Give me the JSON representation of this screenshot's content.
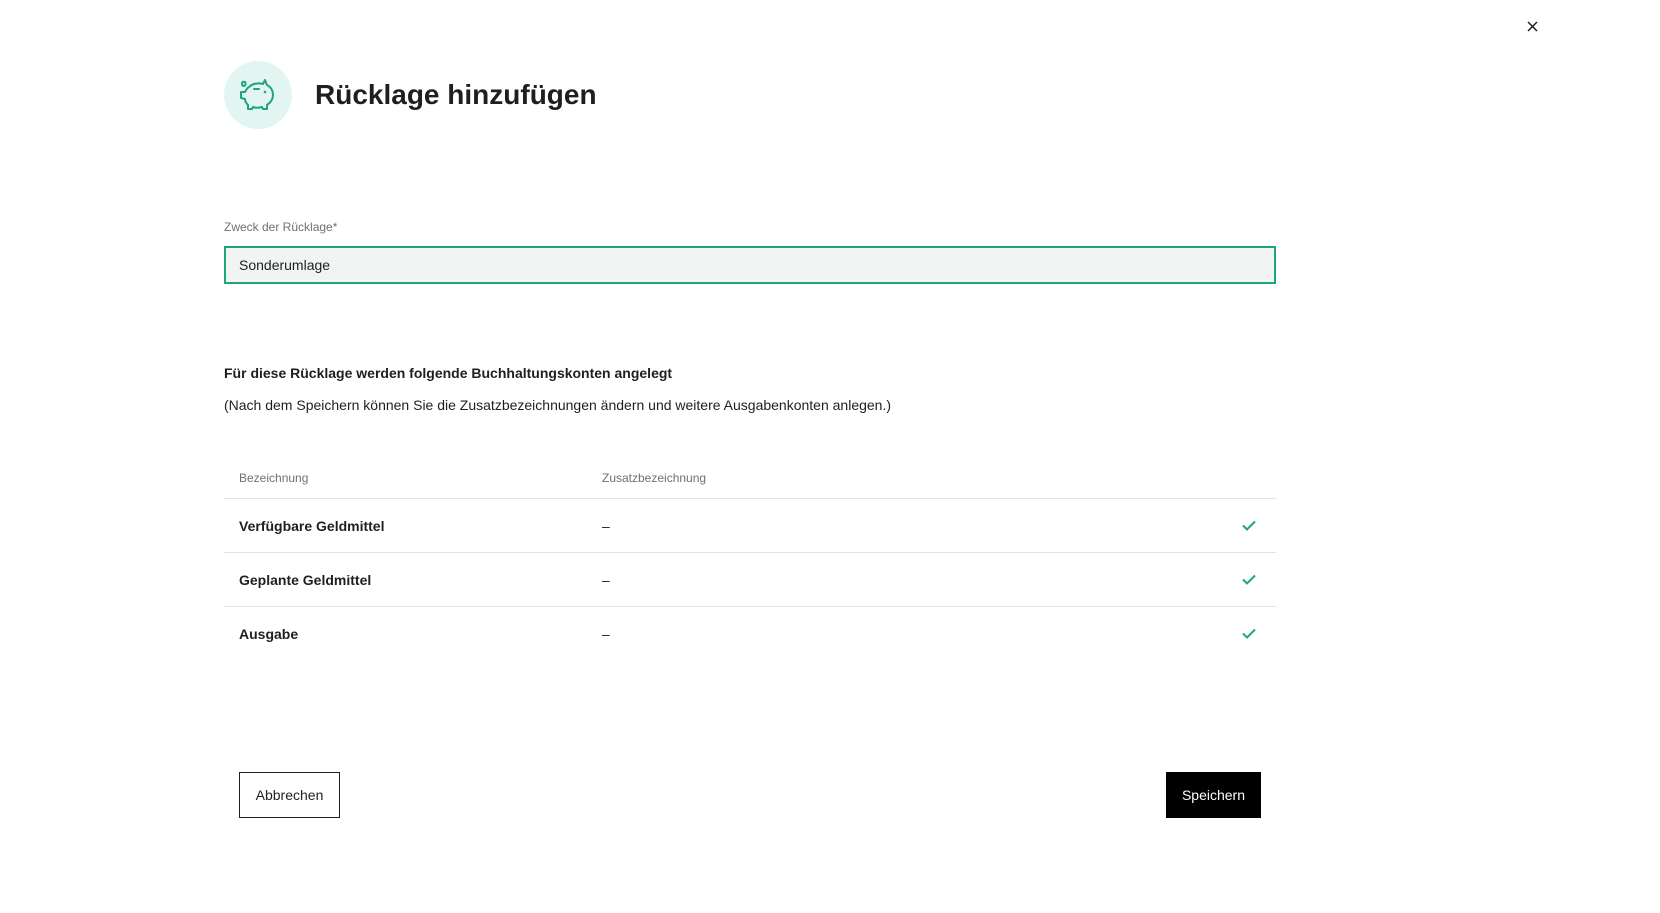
{
  "dialog": {
    "title": "Rücklage hinzufügen",
    "close_icon": "close-icon",
    "header_icon": "piggy-bank-icon"
  },
  "form": {
    "purpose_label": "Zweck der Rücklage*",
    "purpose_value": "Sonderumlage"
  },
  "accounts": {
    "heading": "Für diese Rücklage werden folgende Buchhaltungskonten angelegt",
    "note": "(Nach dem Speichern können Sie die Zusatzbezeichnungen ändern und weitere Ausgabenkonten anlegen.)",
    "columns": [
      "Bezeichnung",
      "Zusatzbezeichnung"
    ],
    "rows": [
      {
        "name": "Verfügbare Geldmittel",
        "extra": "–"
      },
      {
        "name": "Geplante Geldmittel",
        "extra": "–"
      },
      {
        "name": "Ausgabe",
        "extra": "–"
      }
    ],
    "status_icon": "check-icon"
  },
  "actions": {
    "cancel_label": "Abbrechen",
    "save_label": "Speichern"
  },
  "colors": {
    "accent": "#1ea57e",
    "icon_background": "#e3f5f0",
    "input_background": "#f2f4f4",
    "primary_button": "#000000"
  }
}
